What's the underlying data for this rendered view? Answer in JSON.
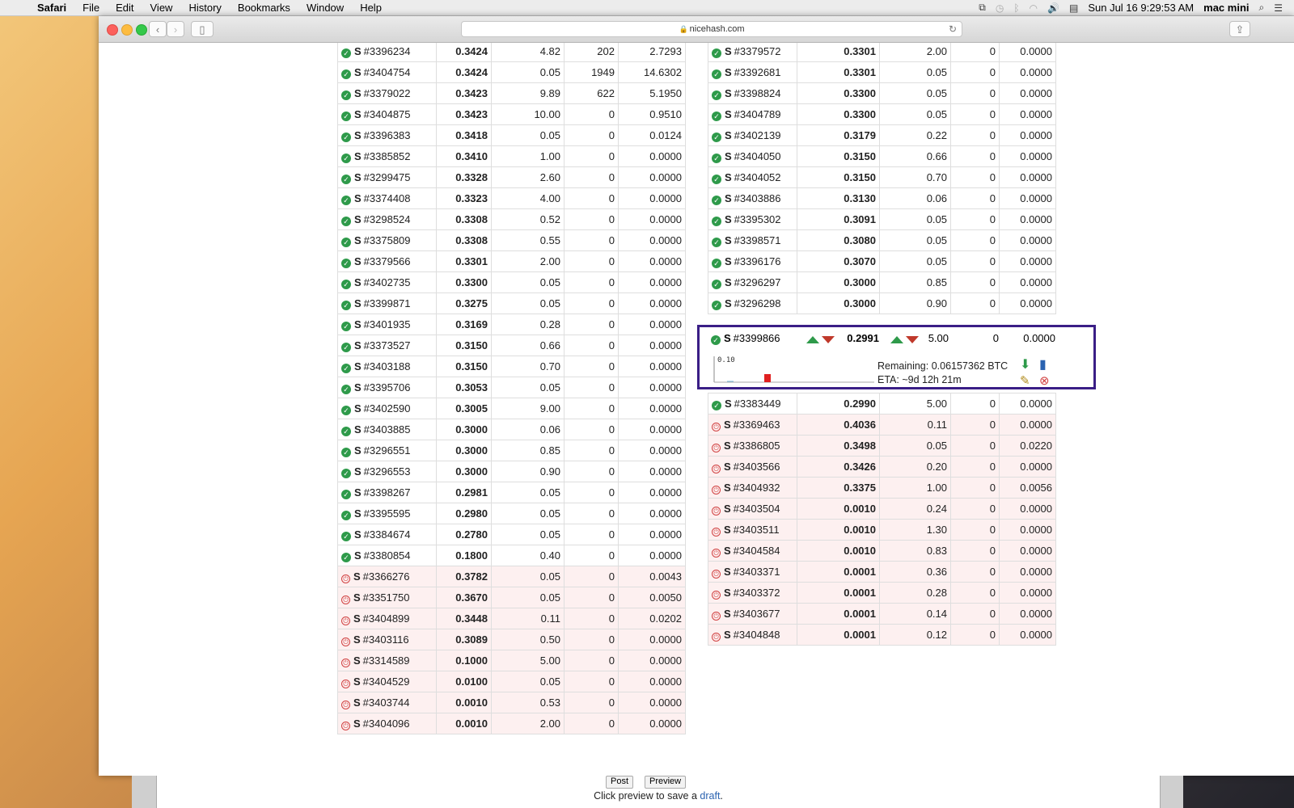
{
  "menubar": {
    "app": "Safari",
    "items": [
      "File",
      "Edit",
      "View",
      "History",
      "Bookmarks",
      "Window",
      "Help"
    ],
    "clock": "Sun Jul 16  9:29:53 AM",
    "user": "mac mini"
  },
  "browser": {
    "url": "nicehash.com"
  },
  "left_table": [
    {
      "status": "ok",
      "id": "#3396234",
      "price": "0.3424",
      "limit": "4.82",
      "speed": "202",
      "paid": "2.7293"
    },
    {
      "status": "ok",
      "id": "#3404754",
      "price": "0.3424",
      "limit": "0.05",
      "speed": "1949",
      "paid": "14.6302"
    },
    {
      "status": "ok",
      "id": "#3379022",
      "price": "0.3423",
      "limit": "9.89",
      "speed": "622",
      "paid": "5.1950"
    },
    {
      "status": "ok",
      "id": "#3404875",
      "price": "0.3423",
      "limit": "10.00",
      "speed": "0",
      "paid": "0.9510"
    },
    {
      "status": "ok",
      "id": "#3396383",
      "price": "0.3418",
      "limit": "0.05",
      "speed": "0",
      "paid": "0.0124"
    },
    {
      "status": "ok",
      "id": "#3385852",
      "price": "0.3410",
      "limit": "1.00",
      "speed": "0",
      "paid": "0.0000"
    },
    {
      "status": "ok",
      "id": "#3299475",
      "price": "0.3328",
      "limit": "2.60",
      "speed": "0",
      "paid": "0.0000"
    },
    {
      "status": "ok",
      "id": "#3374408",
      "price": "0.3323",
      "limit": "4.00",
      "speed": "0",
      "paid": "0.0000"
    },
    {
      "status": "ok",
      "id": "#3298524",
      "price": "0.3308",
      "limit": "0.52",
      "speed": "0",
      "paid": "0.0000"
    },
    {
      "status": "ok",
      "id": "#3375809",
      "price": "0.3308",
      "limit": "0.55",
      "speed": "0",
      "paid": "0.0000"
    },
    {
      "status": "ok",
      "id": "#3379566",
      "price": "0.3301",
      "limit": "2.00",
      "speed": "0",
      "paid": "0.0000"
    },
    {
      "status": "ok",
      "id": "#3402735",
      "price": "0.3300",
      "limit": "0.05",
      "speed": "0",
      "paid": "0.0000"
    },
    {
      "status": "ok",
      "id": "#3399871",
      "price": "0.3275",
      "limit": "0.05",
      "speed": "0",
      "paid": "0.0000"
    },
    {
      "status": "ok",
      "id": "#3401935",
      "price": "0.3169",
      "limit": "0.28",
      "speed": "0",
      "paid": "0.0000"
    },
    {
      "status": "ok",
      "id": "#3373527",
      "price": "0.3150",
      "limit": "0.66",
      "speed": "0",
      "paid": "0.0000"
    },
    {
      "status": "ok",
      "id": "#3403188",
      "price": "0.3150",
      "limit": "0.70",
      "speed": "0",
      "paid": "0.0000"
    },
    {
      "status": "ok",
      "id": "#3395706",
      "price": "0.3053",
      "limit": "0.05",
      "speed": "0",
      "paid": "0.0000"
    },
    {
      "status": "ok",
      "id": "#3402590",
      "price": "0.3005",
      "limit": "9.00",
      "speed": "0",
      "paid": "0.0000"
    },
    {
      "status": "ok",
      "id": "#3403885",
      "price": "0.3000",
      "limit": "0.06",
      "speed": "0",
      "paid": "0.0000"
    },
    {
      "status": "ok",
      "id": "#3296551",
      "price": "0.3000",
      "limit": "0.85",
      "speed": "0",
      "paid": "0.0000"
    },
    {
      "status": "ok",
      "id": "#3296553",
      "price": "0.3000",
      "limit": "0.90",
      "speed": "0",
      "paid": "0.0000"
    },
    {
      "status": "ok",
      "id": "#3398267",
      "price": "0.2981",
      "limit": "0.05",
      "speed": "0",
      "paid": "0.0000"
    },
    {
      "status": "ok",
      "id": "#3395595",
      "price": "0.2980",
      "limit": "0.05",
      "speed": "0",
      "paid": "0.0000"
    },
    {
      "status": "ok",
      "id": "#3384674",
      "price": "0.2780",
      "limit": "0.05",
      "speed": "0",
      "paid": "0.0000"
    },
    {
      "status": "ok",
      "id": "#3380854",
      "price": "0.1800",
      "limit": "0.40",
      "speed": "0",
      "paid": "0.0000"
    },
    {
      "status": "off",
      "id": "#3366276",
      "price": "0.3782",
      "limit": "0.05",
      "speed": "0",
      "paid": "0.0043"
    },
    {
      "status": "off",
      "id": "#3351750",
      "price": "0.3670",
      "limit": "0.05",
      "speed": "0",
      "paid": "0.0050"
    },
    {
      "status": "off",
      "id": "#3404899",
      "price": "0.3448",
      "limit": "0.11",
      "speed": "0",
      "paid": "0.0202"
    },
    {
      "status": "off",
      "id": "#3403116",
      "price": "0.3089",
      "limit": "0.50",
      "speed": "0",
      "paid": "0.0000"
    },
    {
      "status": "off",
      "id": "#3314589",
      "price": "0.1000",
      "limit": "5.00",
      "speed": "0",
      "paid": "0.0000"
    },
    {
      "status": "off",
      "id": "#3404529",
      "price": "0.0100",
      "limit": "0.05",
      "speed": "0",
      "paid": "0.0000"
    },
    {
      "status": "off",
      "id": "#3403744",
      "price": "0.0010",
      "limit": "0.53",
      "speed": "0",
      "paid": "0.0000"
    },
    {
      "status": "off",
      "id": "#3404096",
      "price": "0.0010",
      "limit": "2.00",
      "speed": "0",
      "paid": "0.0000"
    }
  ],
  "right_table_top": [
    {
      "status": "ok",
      "id": "#3379572",
      "price": "0.3301",
      "limit": "2.00",
      "speed": "0",
      "paid": "0.0000"
    },
    {
      "status": "ok",
      "id": "#3392681",
      "price": "0.3301",
      "limit": "0.05",
      "speed": "0",
      "paid": "0.0000"
    },
    {
      "status": "ok",
      "id": "#3398824",
      "price": "0.3300",
      "limit": "0.05",
      "speed": "0",
      "paid": "0.0000"
    },
    {
      "status": "ok",
      "id": "#3404789",
      "price": "0.3300",
      "limit": "0.05",
      "speed": "0",
      "paid": "0.0000"
    },
    {
      "status": "ok",
      "id": "#3402139",
      "price": "0.3179",
      "limit": "0.22",
      "speed": "0",
      "paid": "0.0000"
    },
    {
      "status": "ok",
      "id": "#3404050",
      "price": "0.3150",
      "limit": "0.66",
      "speed": "0",
      "paid": "0.0000"
    },
    {
      "status": "ok",
      "id": "#3404052",
      "price": "0.3150",
      "limit": "0.70",
      "speed": "0",
      "paid": "0.0000"
    },
    {
      "status": "ok",
      "id": "#3403886",
      "price": "0.3130",
      "limit": "0.06",
      "speed": "0",
      "paid": "0.0000"
    },
    {
      "status": "ok",
      "id": "#3395302",
      "price": "0.3091",
      "limit": "0.05",
      "speed": "0",
      "paid": "0.0000"
    },
    {
      "status": "ok",
      "id": "#3398571",
      "price": "0.3080",
      "limit": "0.05",
      "speed": "0",
      "paid": "0.0000"
    },
    {
      "status": "ok",
      "id": "#3396176",
      "price": "0.3070",
      "limit": "0.05",
      "speed": "0",
      "paid": "0.0000"
    },
    {
      "status": "ok",
      "id": "#3296297",
      "price": "0.3000",
      "limit": "0.85",
      "speed": "0",
      "paid": "0.0000"
    },
    {
      "status": "ok",
      "id": "#3296298",
      "price": "0.3000",
      "limit": "0.90",
      "speed": "0",
      "paid": "0.0000"
    }
  ],
  "selected_order": {
    "status": "ok",
    "id": "#3399866",
    "price": "0.2991",
    "limit": "5.00",
    "speed": "0",
    "paid": "0.0000",
    "chart_label": "0.10",
    "remaining": "Remaining: 0.06157362 BTC",
    "eta": "ETA: ~9d 12h 21m"
  },
  "right_table_bottom": [
    {
      "status": "ok",
      "id": "#3383449",
      "price": "0.2990",
      "limit": "5.00",
      "speed": "0",
      "paid": "0.0000"
    },
    {
      "status": "off",
      "id": "#3369463",
      "price": "0.4036",
      "limit": "0.11",
      "speed": "0",
      "paid": "0.0000"
    },
    {
      "status": "off",
      "id": "#3386805",
      "price": "0.3498",
      "limit": "0.05",
      "speed": "0",
      "paid": "0.0220"
    },
    {
      "status": "off",
      "id": "#3403566",
      "price": "0.3426",
      "limit": "0.20",
      "speed": "0",
      "paid": "0.0000"
    },
    {
      "status": "off",
      "id": "#3404932",
      "price": "0.3375",
      "limit": "1.00",
      "speed": "0",
      "paid": "0.0056"
    },
    {
      "status": "off",
      "id": "#3403504",
      "price": "0.0010",
      "limit": "0.24",
      "speed": "0",
      "paid": "0.0000"
    },
    {
      "status": "off",
      "id": "#3403511",
      "price": "0.0010",
      "limit": "1.30",
      "speed": "0",
      "paid": "0.0000"
    },
    {
      "status": "off",
      "id": "#3404584",
      "price": "0.0010",
      "limit": "0.83",
      "speed": "0",
      "paid": "0.0000"
    },
    {
      "status": "off",
      "id": "#3403371",
      "price": "0.0001",
      "limit": "0.36",
      "speed": "0",
      "paid": "0.0000"
    },
    {
      "status": "off",
      "id": "#3403372",
      "price": "0.0001",
      "limit": "0.28",
      "speed": "0",
      "paid": "0.0000"
    },
    {
      "status": "off",
      "id": "#3403677",
      "price": "0.0001",
      "limit": "0.14",
      "speed": "0",
      "paid": "0.0000"
    },
    {
      "status": "off",
      "id": "#3404848",
      "price": "0.0001",
      "limit": "0.12",
      "speed": "0",
      "paid": "0.0000"
    }
  ],
  "order_prefix": "S",
  "bottom": {
    "post": "Post",
    "preview": "Preview",
    "hint_before": "Click preview to save a ",
    "hint_link": "draft",
    "hint_after": "."
  }
}
